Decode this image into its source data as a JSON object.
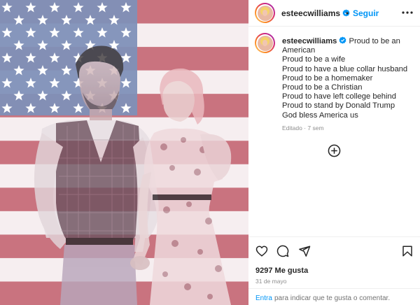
{
  "post": {
    "username": "esteecwilliams",
    "follow_label": "Seguir",
    "separator": "•",
    "caption_lines": [
      "Proud to be an American",
      "Proud to be a wife",
      "Proud to have a blue collar husband",
      "Proud to be a homemaker",
      "Proud to be a Christian",
      "Proud to have left college behind",
      "Proud to stand by Donald Trump",
      "God bless America us"
    ],
    "edited_label": "Editado",
    "age": "7 sem",
    "likes": "9297 Me gusta",
    "date": "31 de mayo",
    "comment_link": "Entra",
    "comment_rest": "para indicar que te gusta o comentar."
  },
  "icons": {
    "more": "more-options-icon",
    "verified": "verified-badge-icon",
    "add_comment": "add-circle-icon",
    "like": "heart-icon",
    "comment": "comment-icon",
    "share": "send-icon",
    "save": "bookmark-icon"
  },
  "colors": {
    "link_blue": "#0095f6",
    "flag_red": "#c9737f",
    "flag_blue": "#7c8fb8",
    "muted": "#8e8e8e"
  }
}
